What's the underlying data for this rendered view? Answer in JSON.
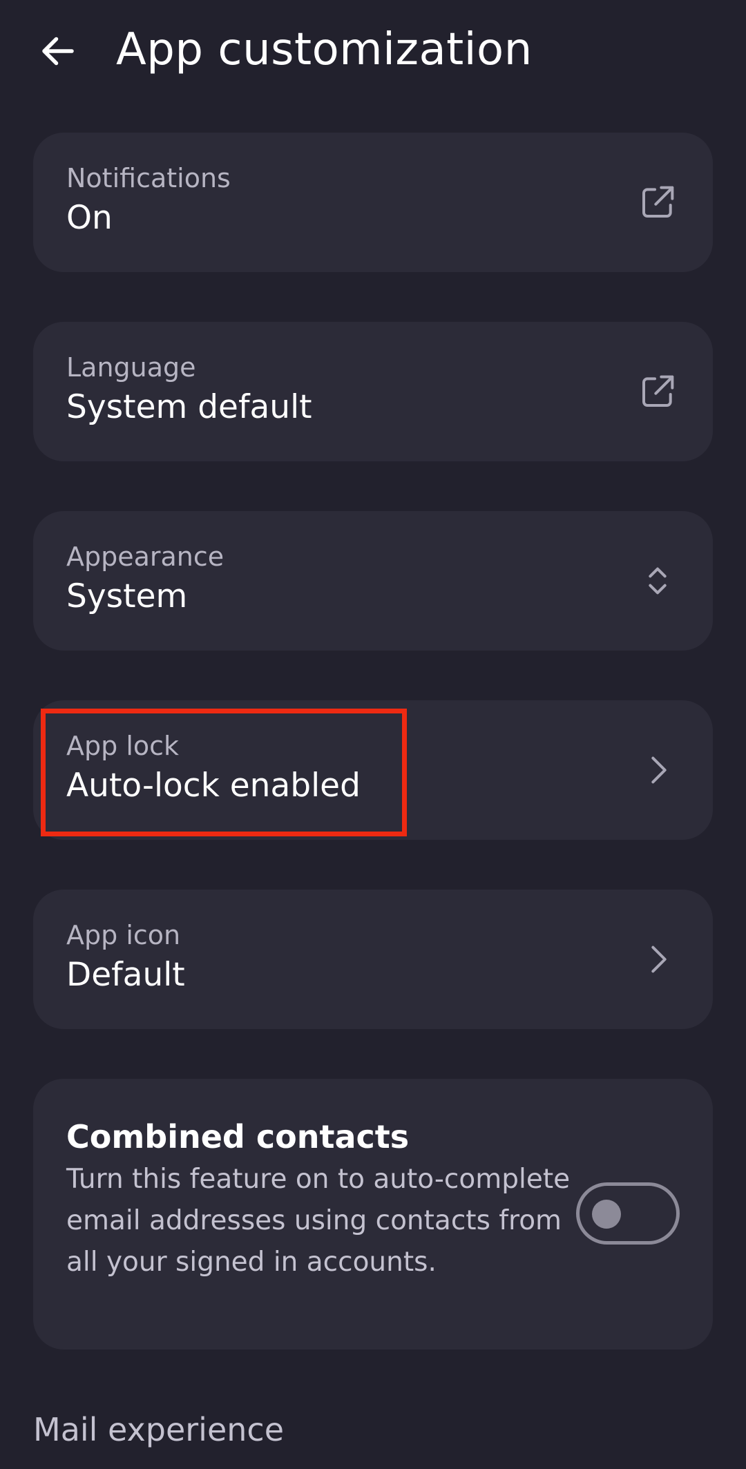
{
  "header": {
    "title": "App customization",
    "back_icon": "arrow-back-icon"
  },
  "settings": {
    "notifications": {
      "label": "Notifications",
      "value": "On",
      "icon": "external-link-icon"
    },
    "language": {
      "label": "Language",
      "value": "System default",
      "icon": "external-link-icon"
    },
    "appearance": {
      "label": "Appearance",
      "value": "System",
      "icon": "expand-collapse-icon"
    },
    "app_lock": {
      "label": "App lock",
      "value": "Auto-lock enabled",
      "icon": "chevron-right-icon"
    },
    "app_icon": {
      "label": "App icon",
      "value": "Default",
      "icon": "chevron-right-icon"
    }
  },
  "combined_contacts": {
    "title": "Combined contacts",
    "description": "Turn this feature on to auto-complete email addresses using contacts from all your signed in accounts.",
    "toggle_on": false
  },
  "sections": {
    "mail_experience": "Mail experience"
  },
  "colors": {
    "background": "#22212d",
    "card": "#2c2b38",
    "highlight": "#ee2a12"
  }
}
